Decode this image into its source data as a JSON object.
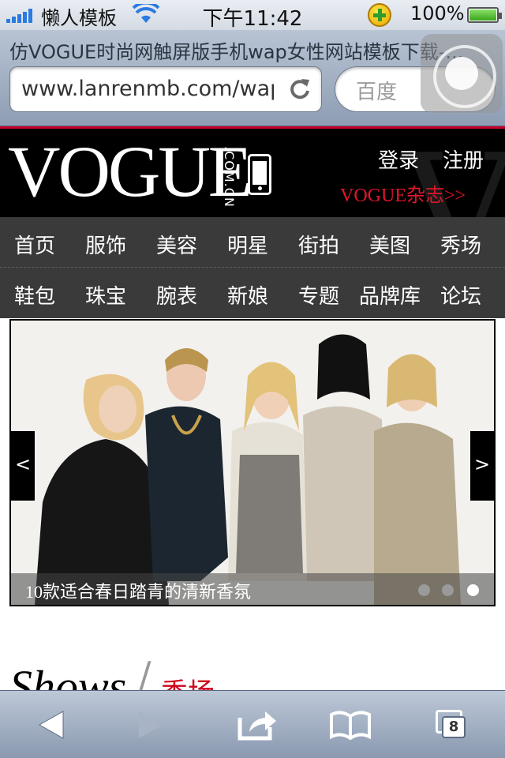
{
  "status_bar": {
    "carrier": "懒人模板",
    "time": "下午11:42",
    "battery": "100%"
  },
  "browser": {
    "page_title": "仿VOGUE时尚网触屏版手机wap女性网站模板下载-...",
    "url": "www.lanrenmb.com/wap",
    "search_placeholder": "百度"
  },
  "header": {
    "logo": "VOGUE",
    "logo_sub": ".COM.CN",
    "login": "登录",
    "register": "注册",
    "magazine": "VOGUE杂志>>"
  },
  "nav": {
    "row1": [
      "首页",
      "服饰",
      "美容",
      "明星",
      "街拍",
      "美图",
      "秀场"
    ],
    "row2": [
      "鞋包",
      "珠宝",
      "腕表",
      "新娘",
      "专题",
      "品牌库",
      "论坛"
    ]
  },
  "banner": {
    "caption": "10款适合春日踏青的清新香氛",
    "prev": "<",
    "next": ">",
    "slide_count": 3,
    "active_slide": 3
  },
  "section": {
    "title_en": "Shows",
    "slash": "/",
    "title_cn": "秀场"
  },
  "toolbar": {
    "tabs_count": "8"
  },
  "colors": {
    "accent_red": "#c8002a",
    "header_bg": "#000000",
    "nav_bg": "#3a3a3a"
  }
}
